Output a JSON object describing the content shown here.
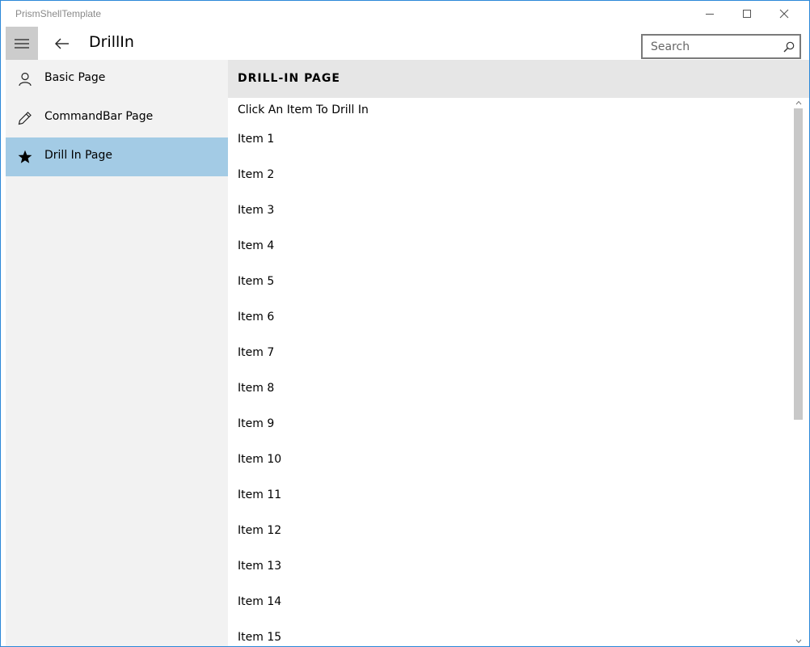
{
  "window": {
    "title": "PrismShellTemplate"
  },
  "header": {
    "page_title": "DrillIn",
    "search_placeholder": "Search"
  },
  "icons": {
    "minimize": "minimize-icon",
    "maximize": "maximize-icon",
    "close": "close-icon",
    "hamburger": "hamburger-icon",
    "back": "back-arrow-icon",
    "search": "search-icon"
  },
  "nav": {
    "items": [
      {
        "label": "Basic Page",
        "icon": "person-icon",
        "selected": false
      },
      {
        "label": "CommandBar Page",
        "icon": "pencil-icon",
        "selected": false
      },
      {
        "label": "Drill In Page",
        "icon": "star-icon",
        "selected": true
      }
    ]
  },
  "content": {
    "header_title": "DRILL-IN PAGE",
    "instruction": "Click An Item To Drill In",
    "items": [
      "Item 1",
      "Item 2",
      "Item 3",
      "Item 4",
      "Item 5",
      "Item 6",
      "Item 7",
      "Item 8",
      "Item 9",
      "Item 10",
      "Item 11",
      "Item 12",
      "Item 13",
      "Item 14",
      "Item 15"
    ]
  },
  "colors": {
    "window_border": "#2b88d8",
    "nav_background": "#f2f2f2",
    "nav_selected": "#a3cbe5",
    "hamburger_background": "#cccccc",
    "content_header_background": "#e6e6e6"
  }
}
